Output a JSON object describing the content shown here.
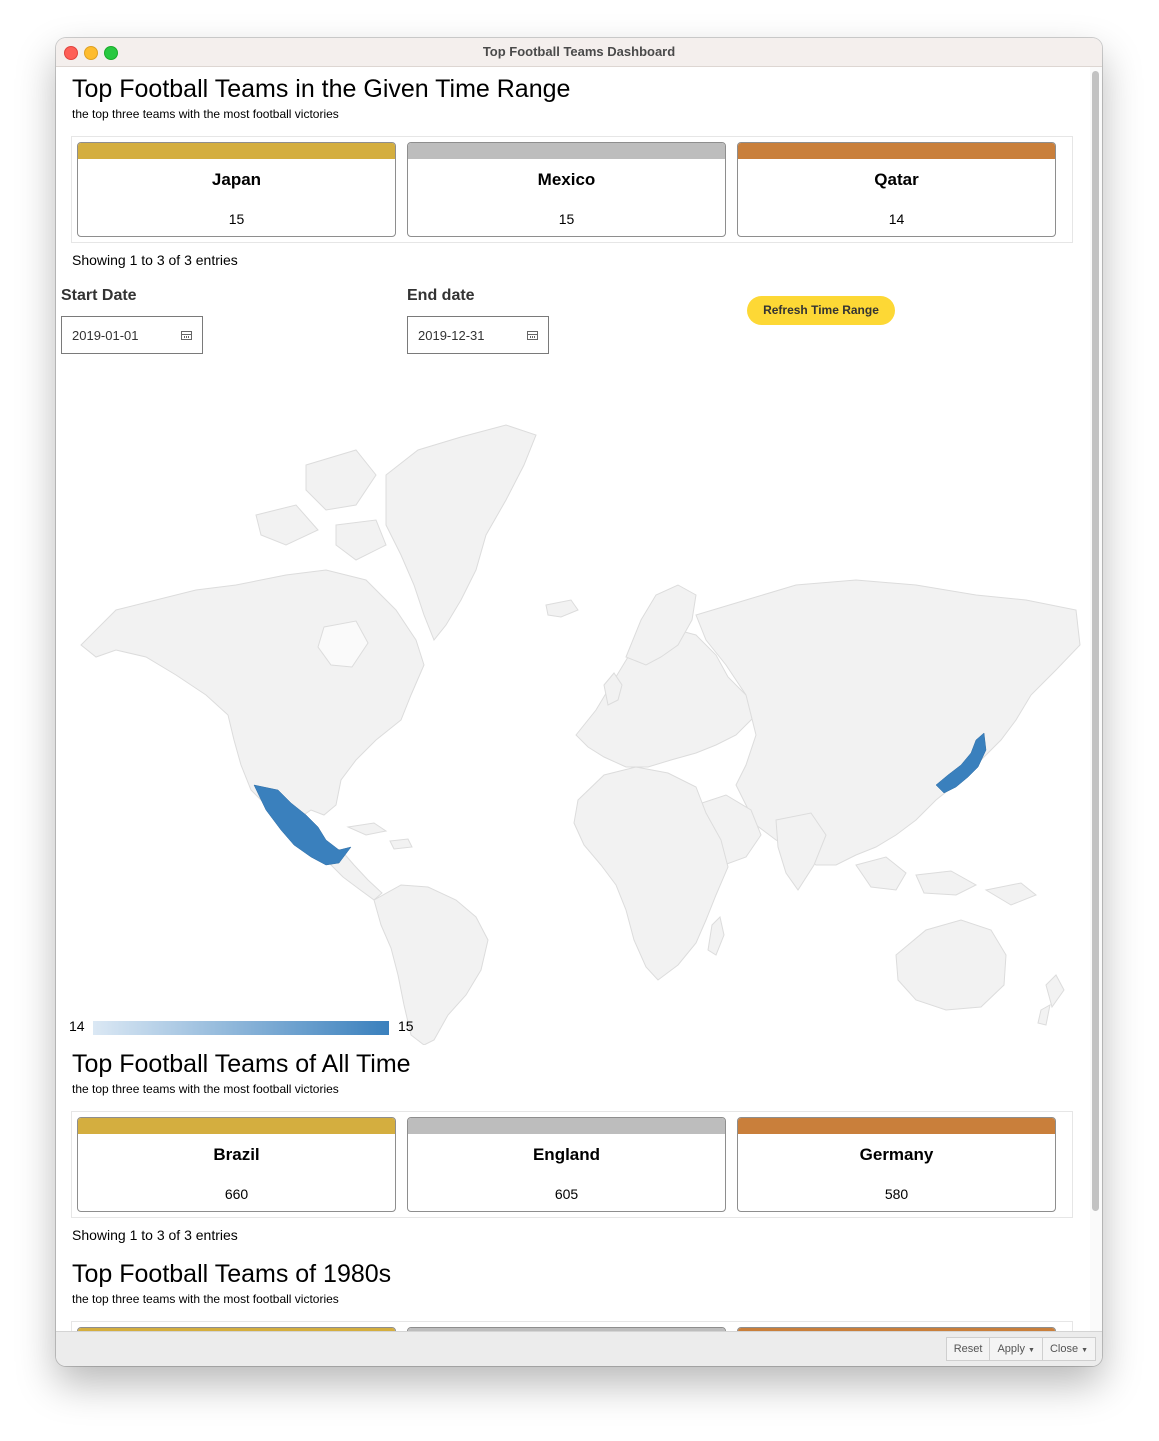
{
  "window": {
    "title": "Top Football Teams Dashboard"
  },
  "colors": {
    "gold": "#d4ae3f",
    "silver": "#bdbdbd",
    "bronze": "#c97f3b",
    "highlight": "#3a80bd",
    "button": "#fdd835"
  },
  "section1": {
    "title": "Top Football Teams in the Given Time Range",
    "subtitle": "the top three teams with the most football victories",
    "cards": [
      {
        "name": "Japan",
        "value": "15"
      },
      {
        "name": "Mexico",
        "value": "15"
      },
      {
        "name": "Qatar",
        "value": "14"
      }
    ],
    "showing": "Showing 1 to 3 of 3 entries"
  },
  "filters": {
    "start_label": "Start Date",
    "start_value": "2019-01-01",
    "end_label": "End date",
    "end_value": "2019-12-31",
    "refresh_label": "Refresh Time Range"
  },
  "map": {
    "highlighted_countries": [
      "Mexico",
      "Japan"
    ],
    "legend_min": "14",
    "legend_max": "15"
  },
  "section2": {
    "title": "Top Football Teams of All Time",
    "subtitle": "the top three teams with the most football victories",
    "cards": [
      {
        "name": "Brazil",
        "value": "660"
      },
      {
        "name": "England",
        "value": "605"
      },
      {
        "name": "Germany",
        "value": "580"
      }
    ],
    "showing": "Showing 1 to 3 of 3 entries"
  },
  "section3": {
    "title": "Top Football Teams of 1980s",
    "subtitle": "the top three teams with the most football victories"
  },
  "bottombar": {
    "reset": "Reset",
    "apply": "Apply",
    "close": "Close"
  }
}
